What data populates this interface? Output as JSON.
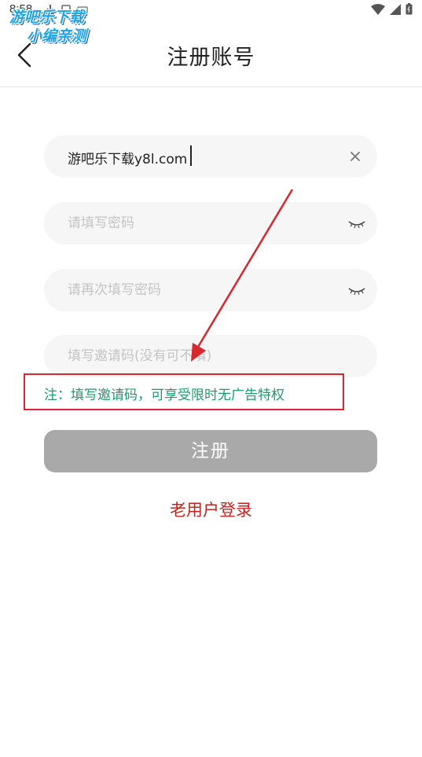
{
  "status_bar": {
    "time": "8:58"
  },
  "watermark": {
    "line1": "游吧乐下载",
    "line2": "小编亲测"
  },
  "header": {
    "title": "注册账号"
  },
  "form": {
    "username": {
      "value": "游吧乐下载y8l.com"
    },
    "password": {
      "placeholder": "请填写密码"
    },
    "confirm_password": {
      "placeholder": "请再次填写密码"
    },
    "invite_code": {
      "placeholder": "填写邀请码(没有可不填)"
    }
  },
  "note": {
    "text": "注：填写邀请码，可享受限时无广告特权"
  },
  "actions": {
    "register_label": "注册",
    "login_link": "老用户登录"
  },
  "colors": {
    "annotation_red": "#d6282e",
    "note_green": "#1e9b6b",
    "link_red": "#c0261f",
    "button_gray": "#a9a9a9"
  },
  "icons": {
    "back": "chevron-left-icon",
    "clear": "close-icon",
    "eye": "eye-closed-icon"
  }
}
